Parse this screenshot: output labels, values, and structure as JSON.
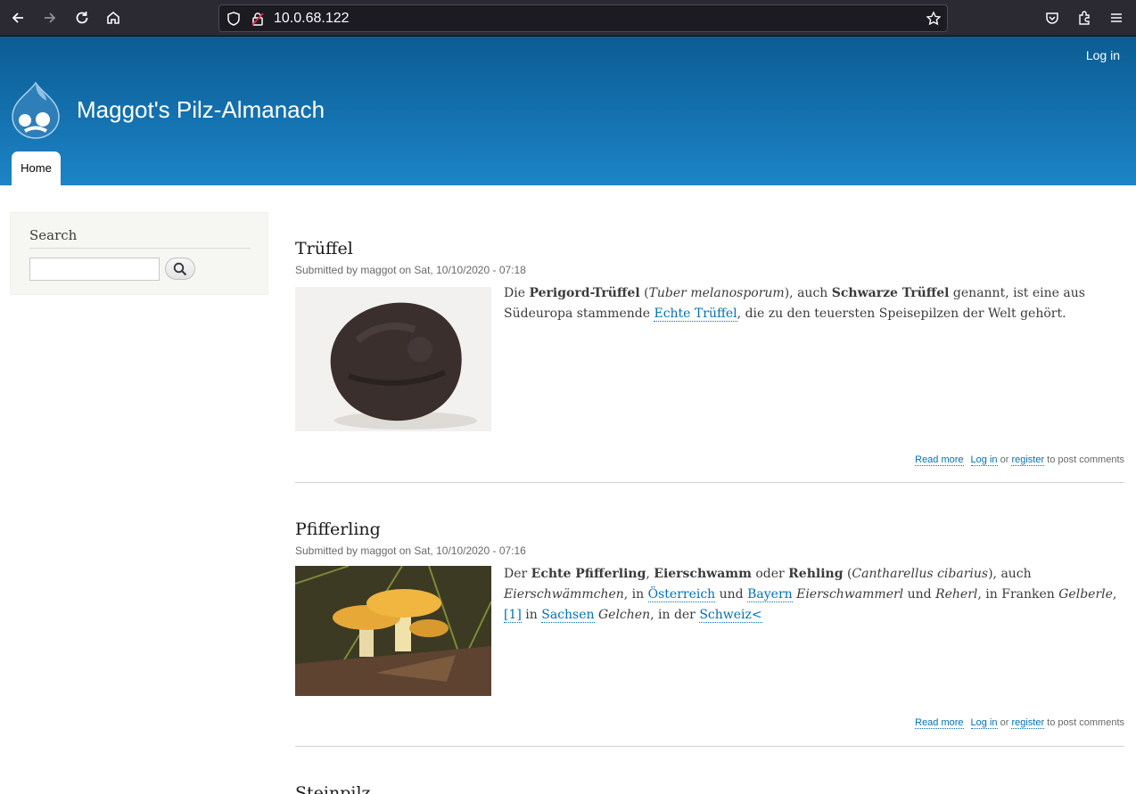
{
  "browser": {
    "url": "10.0.68.122"
  },
  "site": {
    "name": "Maggot's Pilz-Almanach",
    "login": "Log in",
    "tabs": [
      "Home"
    ]
  },
  "sidebar": {
    "search_title": "Search",
    "search_value": ""
  },
  "articles": [
    {
      "title": "Trüffel",
      "submitted": "Submitted by maggot on Sat, 10/10/2020 - 07:18",
      "body": [
        {
          "t": "Die "
        },
        {
          "t": "Perigord-Trüffel",
          "s": "b"
        },
        {
          "t": " ("
        },
        {
          "t": "Tuber melanosporum",
          "s": "i"
        },
        {
          "t": "), auch "
        },
        {
          "t": "Schwarze Trüffel",
          "s": "b"
        },
        {
          "t": " genannt, ist eine aus Südeuropa stammende "
        },
        {
          "t": "Echte Trüffel",
          "s": "a"
        },
        {
          "t": ", die zu den teuersten Speisepilzen der Welt gehört."
        }
      ],
      "read_more": "Read more",
      "login": "Log in",
      "or": " or ",
      "register": "register",
      "post_comments": " to post comments"
    },
    {
      "title": "Pfifferling",
      "submitted": "Submitted by maggot on Sat, 10/10/2020 - 07:16",
      "body": [
        {
          "t": "Der "
        },
        {
          "t": "Echte Pfifferling",
          "s": "b"
        },
        {
          "t": ", "
        },
        {
          "t": "Eierschwamm",
          "s": "b"
        },
        {
          "t": " oder "
        },
        {
          "t": "Rehling",
          "s": "b"
        },
        {
          "t": " ("
        },
        {
          "t": "Cantharellus cibarius",
          "s": "i"
        },
        {
          "t": "), auch "
        },
        {
          "t": "Eierschwämmchen",
          "s": "i"
        },
        {
          "t": ", in "
        },
        {
          "t": "Österreich",
          "s": "a"
        },
        {
          "t": " und "
        },
        {
          "t": "Bayern",
          "s": "a"
        },
        {
          "t": " "
        },
        {
          "t": "Eierschwammerl",
          "s": "i"
        },
        {
          "t": " und "
        },
        {
          "t": "Reherl",
          "s": "i"
        },
        {
          "t": ", in Franken "
        },
        {
          "t": "Gelberle",
          "s": "i"
        },
        {
          "t": ","
        },
        {
          "t": "[1]",
          "s": "a"
        },
        {
          "t": " in "
        },
        {
          "t": "Sachsen",
          "s": "a"
        },
        {
          "t": " "
        },
        {
          "t": "Gelchen",
          "s": "i"
        },
        {
          "t": ", in der "
        },
        {
          "t": "Schweiz<",
          "s": "a"
        }
      ],
      "read_more": "Read more",
      "login": "Log in",
      "or": " or ",
      "register": "register",
      "post_comments": " to post comments"
    },
    {
      "title": "Steinpilz"
    }
  ]
}
